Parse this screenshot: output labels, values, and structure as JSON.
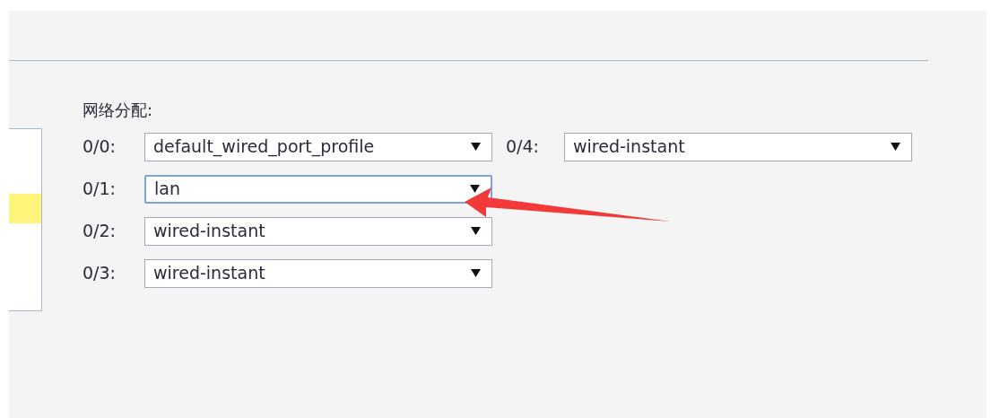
{
  "section": {
    "heading": "网络分配:"
  },
  "port_groups": [
    {
      "ports": [
        {
          "label": "0/0:",
          "value": "default_wired_port_profile",
          "focused": false
        },
        {
          "label": "0/1:",
          "value": "lan",
          "focused": true
        },
        {
          "label": "0/2:",
          "value": "wired-instant",
          "focused": false
        },
        {
          "label": "0/3:",
          "value": "wired-instant",
          "focused": false
        }
      ]
    },
    {
      "ports": [
        {
          "label": "0/4:",
          "value": "wired-instant",
          "focused": false
        }
      ]
    }
  ],
  "side_panel": {
    "highlighted": true
  }
}
